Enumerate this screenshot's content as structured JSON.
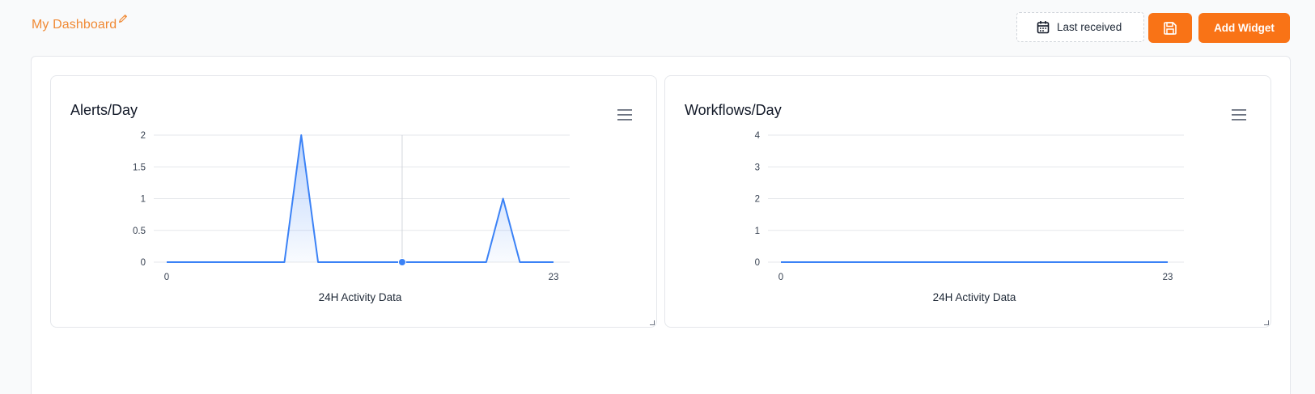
{
  "header": {
    "title": "My Dashboard",
    "range_label": "Last received",
    "add_widget_label": "Add Widget"
  },
  "icons": {
    "edit": "pencil-icon",
    "calendar": "calendar-icon",
    "save": "floppy-disk-icon",
    "menu": "hamburger-menu-icon",
    "resize": "resize-handle-icon"
  },
  "colors": {
    "accent": "#f97316",
    "title": "#f08a35",
    "series": "#3b82f6"
  },
  "widgets": [
    {
      "title": "Alerts/Day"
    },
    {
      "title": "Workflows/Day"
    }
  ],
  "chart_data": [
    {
      "type": "area",
      "title": "Alerts/Day",
      "xlabel": "24H Activity Data",
      "ylabel": "",
      "x": [
        0,
        1,
        2,
        3,
        4,
        5,
        6,
        7,
        8,
        9,
        10,
        11,
        12,
        13,
        14,
        15,
        16,
        17,
        18,
        19,
        20,
        21,
        22,
        23
      ],
      "x_tick_labels": [
        "0",
        "23"
      ],
      "y_ticks": [
        0,
        0.5,
        1,
        1.5,
        2
      ],
      "y_tick_labels": [
        "0",
        "0.5",
        "1",
        "1.5",
        "2"
      ],
      "ylim": [
        0,
        2
      ],
      "grid": true,
      "highlight_x": 14,
      "series": [
        {
          "values": [
            0,
            0,
            0,
            0,
            0,
            0,
            0,
            0,
            2,
            0,
            0,
            0,
            0,
            0,
            0,
            0,
            0,
            0,
            0,
            0,
            1,
            0,
            0,
            0
          ]
        }
      ]
    },
    {
      "type": "line",
      "title": "Workflows/Day",
      "xlabel": "24H Activity Data",
      "ylabel": "",
      "x": [
        0,
        1,
        2,
        3,
        4,
        5,
        6,
        7,
        8,
        9,
        10,
        11,
        12,
        13,
        14,
        15,
        16,
        17,
        18,
        19,
        20,
        21,
        22,
        23
      ],
      "x_tick_labels": [
        "0",
        "23"
      ],
      "y_ticks": [
        0,
        1,
        2,
        3,
        4
      ],
      "y_tick_labels": [
        "0",
        "1",
        "2",
        "3",
        "4"
      ],
      "ylim": [
        0,
        4
      ],
      "grid": true,
      "series": [
        {
          "values": [
            0,
            0,
            0,
            0,
            0,
            0,
            0,
            0,
            0,
            0,
            0,
            0,
            0,
            0,
            0,
            0,
            0,
            0,
            0,
            0,
            0,
            0,
            0,
            0
          ]
        }
      ]
    }
  ]
}
